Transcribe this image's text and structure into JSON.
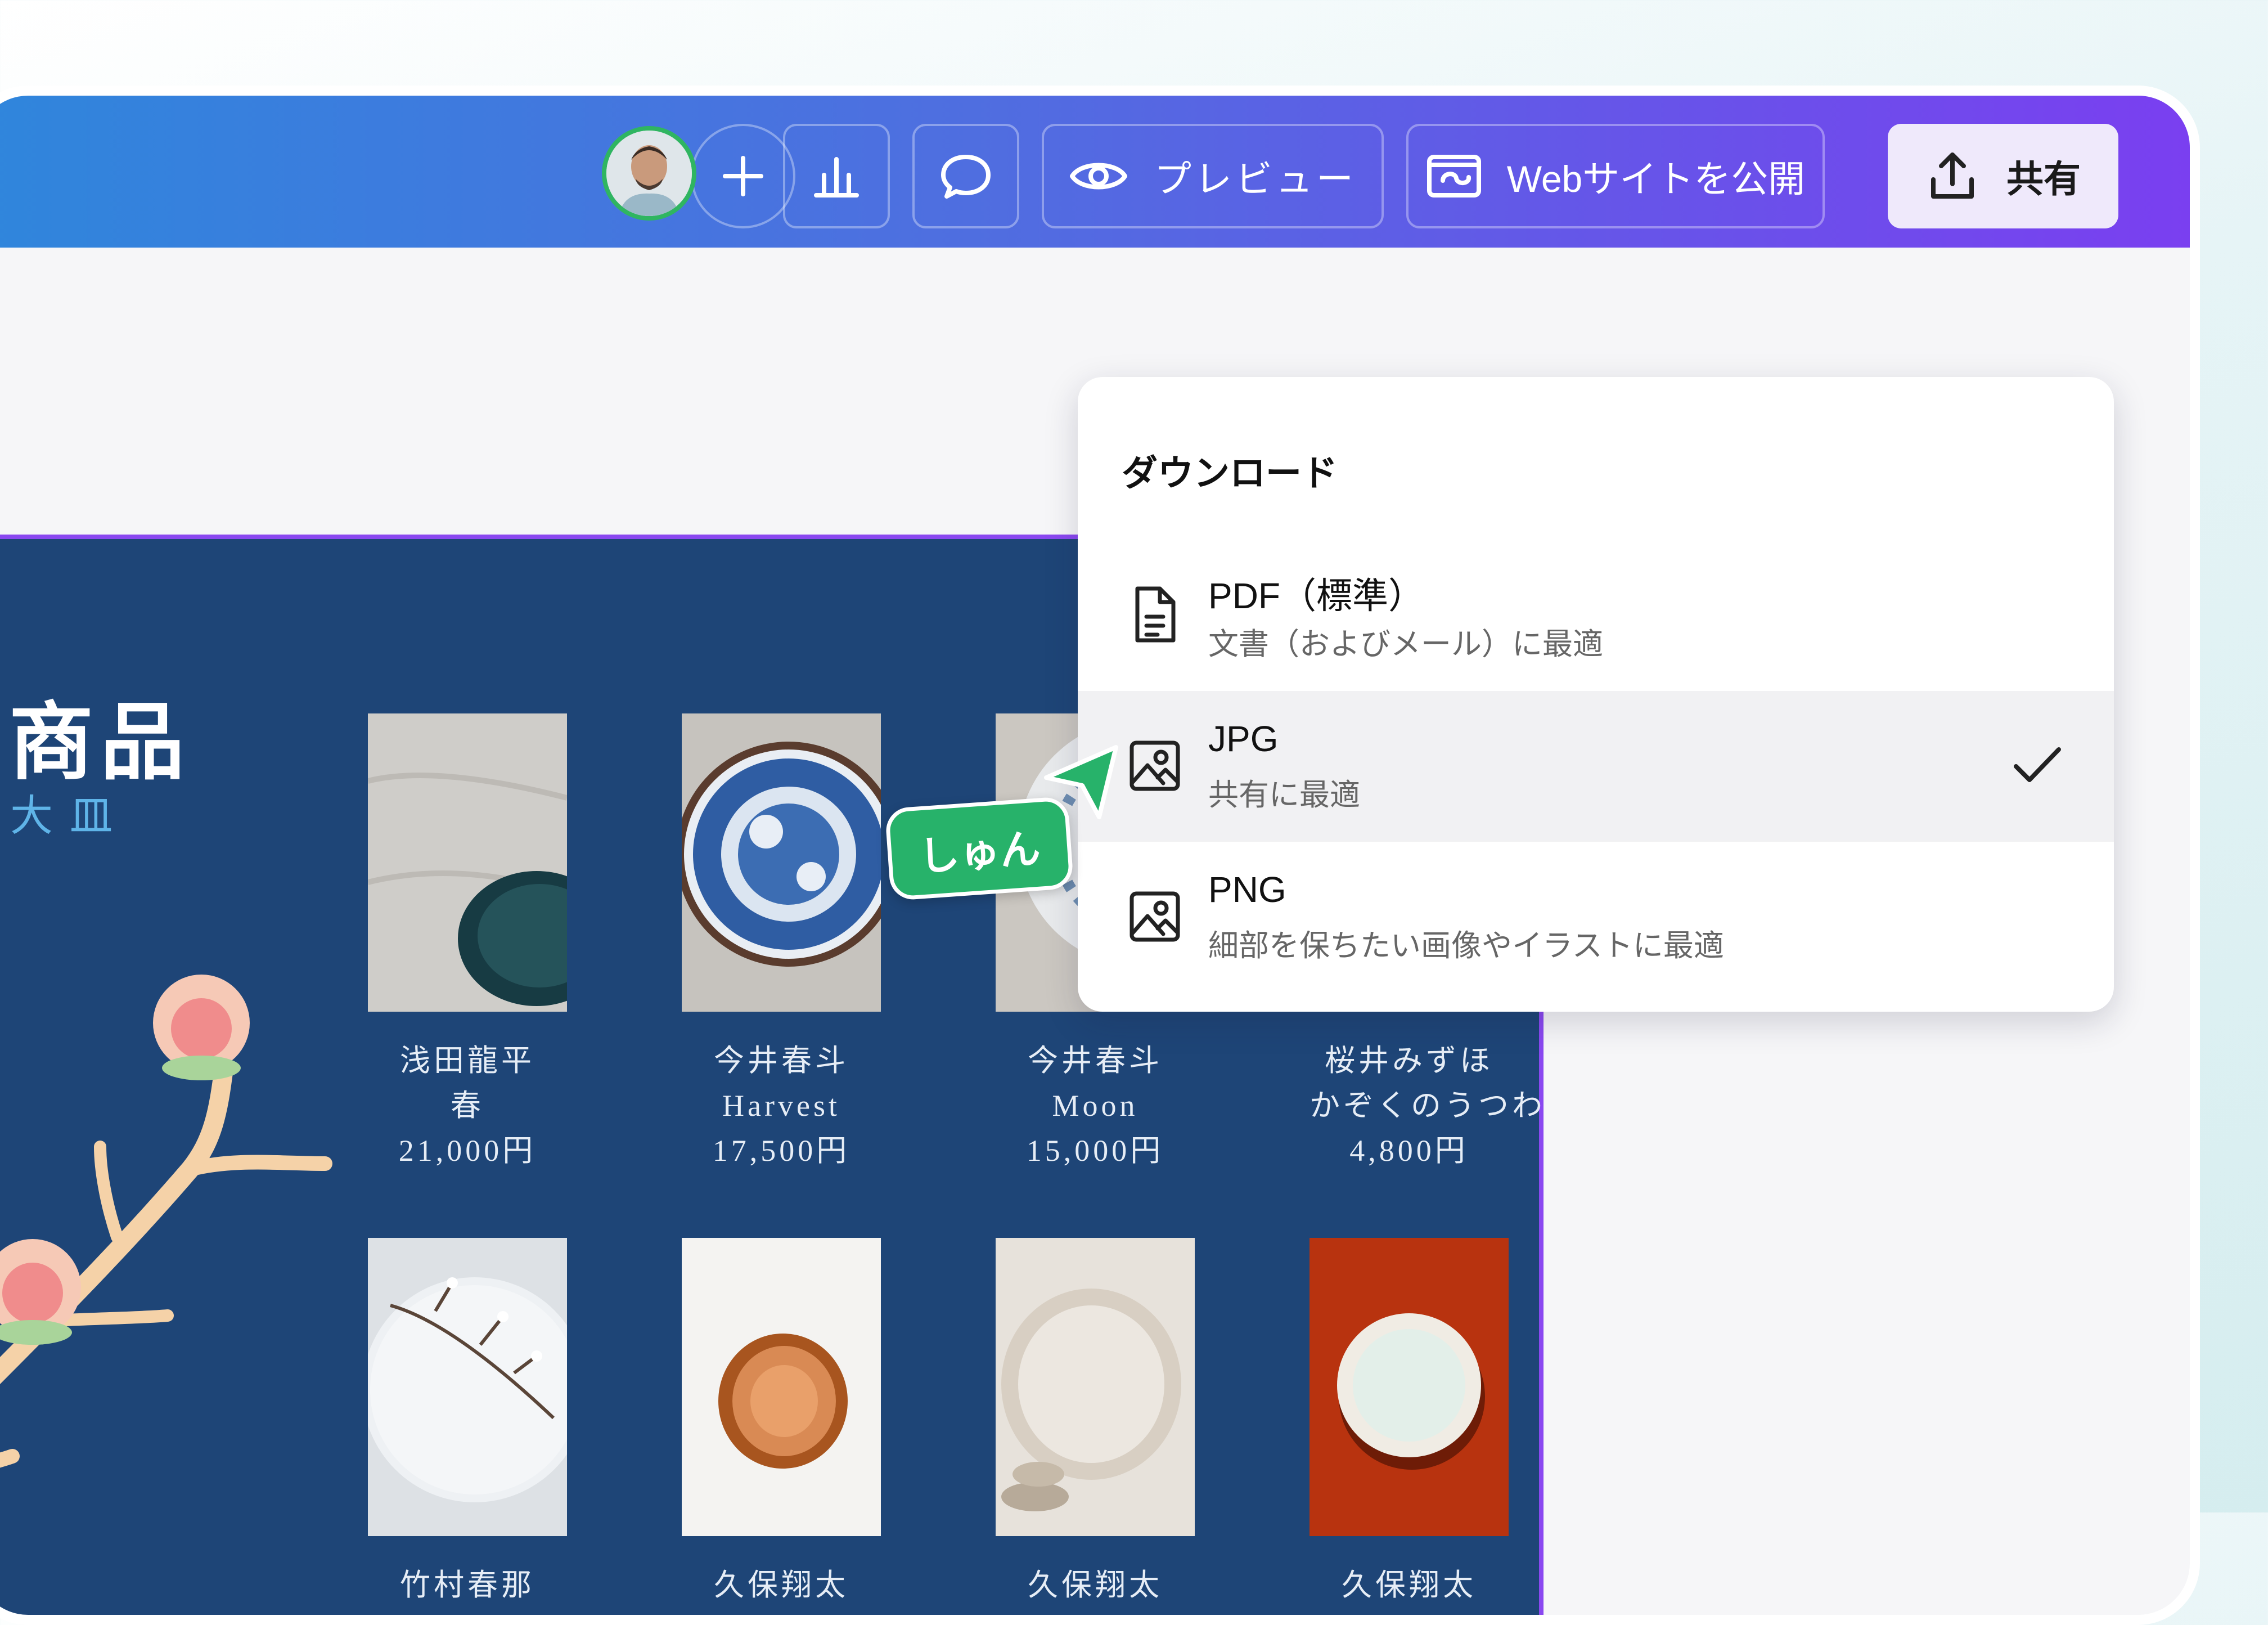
{
  "topbar": {
    "add_label": "+",
    "preview_label": "プレビュー",
    "publish_label": "Webサイトを公開",
    "share_label": "共有"
  },
  "icons": {
    "avatar": "user-avatar",
    "add": "plus-icon",
    "insights": "bar-chart-icon",
    "comment": "speech-bubble-icon",
    "preview": "eye-icon",
    "publish": "website-icon",
    "share": "upload-icon",
    "pdf": "document-icon",
    "jpg": "image-icon",
    "png": "image-icon",
    "selected": "checkmark-icon",
    "collaborator": "cursor-pointer-icon"
  },
  "canvas": {
    "heading": "商品",
    "subheading": "大皿",
    "products": [
      {
        "artist": "浅田龍平",
        "title": "春",
        "price": "21,000円"
      },
      {
        "artist": "今井春斗",
        "title": "Harvest",
        "price": "17,500円"
      },
      {
        "artist": "今井春斗",
        "title": "Moon",
        "price": "15,000円"
      },
      {
        "artist": "桜井みずほ",
        "title": "かぞくのうつわ",
        "price": "4,800円"
      },
      {
        "artist": "竹村春那",
        "title": "",
        "price": ""
      },
      {
        "artist": "久保翔太",
        "title": "",
        "price": ""
      },
      {
        "artist": "久保翔太",
        "title": "",
        "price": ""
      },
      {
        "artist": "久保翔太",
        "title": "",
        "price": ""
      }
    ]
  },
  "download_menu": {
    "title": "ダウンロード",
    "options": [
      {
        "name": "PDF（標準）",
        "description": "文書（およびメール）に最適",
        "selected": false
      },
      {
        "name": "JPG",
        "description": "共有に最適",
        "selected": true
      },
      {
        "name": "PNG",
        "description": "細部を保ちたい画像やイラストに最適",
        "selected": false
      }
    ]
  },
  "collaborator": {
    "name": "しゅん",
    "color": "#27b26a"
  },
  "colors": {
    "brand_gradient_start": "#2f86dc",
    "brand_gradient_end": "#7a3ff0",
    "canvas_bg": "#1e4577",
    "accent_purple": "#8a48f0"
  }
}
